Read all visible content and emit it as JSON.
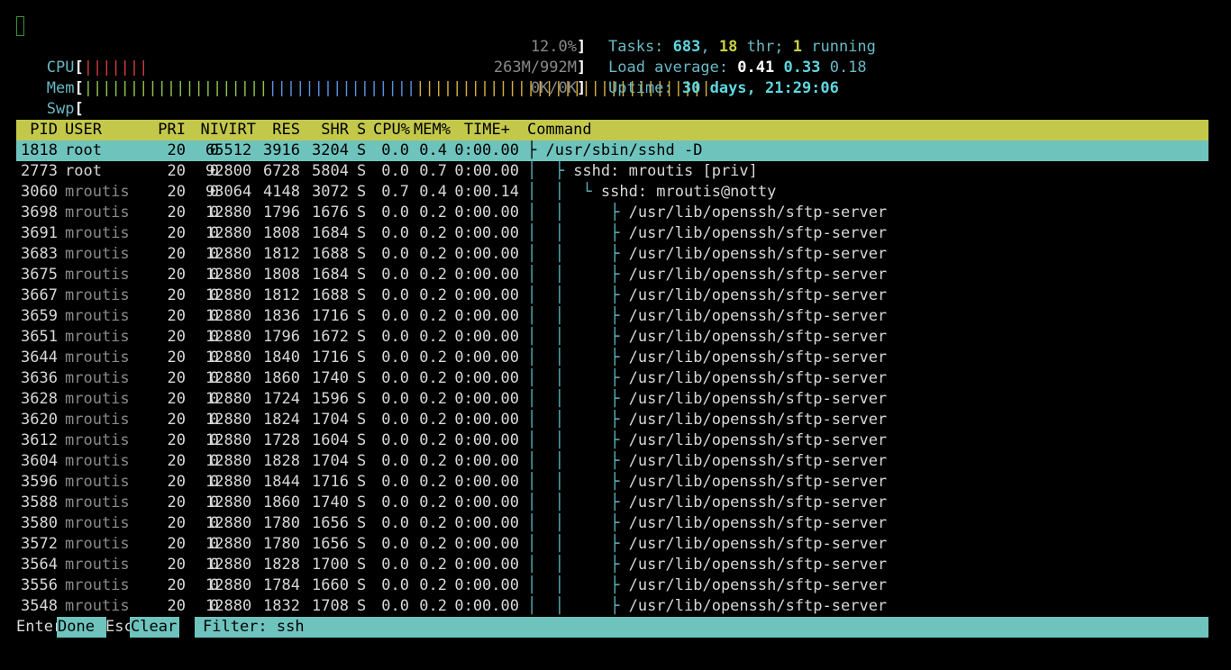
{
  "meters": {
    "cpu": {
      "label": "CPU",
      "value": "12.0%",
      "segments": [
        {
          "color": "#d23c3c",
          "count": 7
        }
      ]
    },
    "mem": {
      "label": "Mem",
      "value": "263M/992M",
      "segments": [
        {
          "color": "#8cc34a",
          "count": 20
        },
        {
          "color": "#5b8fe0",
          "count": 16
        },
        {
          "color": "#d8b03a",
          "count": 32
        }
      ]
    },
    "swp": {
      "label": "Swp",
      "value": "0K/0K",
      "segments": []
    }
  },
  "summary": {
    "tasks_label": "Tasks: ",
    "tasks": "683",
    "thr": "18",
    "thr_label": " thr; ",
    "running": "1",
    "running_label": " running",
    "load_label": "Load average: ",
    "load1": "0.41",
    "load5": "0.33",
    "load15": "0.18",
    "uptime_label": "Uptime: ",
    "uptime": "30 days, 21:29:06"
  },
  "columns": {
    "pid": "PID",
    "user": "USER",
    "pri": "PRI",
    "ni": "NI",
    "virt": "VIRT",
    "res": "RES",
    "shr": "SHR",
    "s": "S",
    "cpu": "CPU%",
    "mem": "MEM%",
    "time": "TIME+",
    "command": "Command"
  },
  "processes": [
    {
      "pid": "1818",
      "user": "root",
      "pri": "20",
      "ni": "0",
      "virt": "65512",
      "res": "3916",
      "shr": "3204",
      "s": "S",
      "cpu": "0.0",
      "mem": "0.4",
      "time": "0:00.00",
      "tree": "├ ",
      "command": "/usr/sbin/sshd -D"
    },
    {
      "pid": "2773",
      "user": "root",
      "pri": "20",
      "ni": "0",
      "virt": "92800",
      "res": "6728",
      "shr": "5804",
      "s": "S",
      "cpu": "0.0",
      "mem": "0.7",
      "time": "0:00.00",
      "tree": "│  ├ ",
      "command": "sshd: mroutis [priv]"
    },
    {
      "pid": "3060",
      "user": "mroutis",
      "pri": "20",
      "ni": "0",
      "virt": "93064",
      "res": "4148",
      "shr": "3072",
      "s": "S",
      "cpu": "0.7",
      "mem": "0.4",
      "time": "0:00.14",
      "tree": "│  │  └ ",
      "command": "sshd: mroutis@notty"
    },
    {
      "pid": "3698",
      "user": "mroutis",
      "pri": "20",
      "ni": "0",
      "virt": "12880",
      "res": "1796",
      "shr": "1676",
      "s": "S",
      "cpu": "0.0",
      "mem": "0.2",
      "time": "0:00.00",
      "tree": "│  │     ├ ",
      "command": "/usr/lib/openssh/sftp-server"
    },
    {
      "pid": "3691",
      "user": "mroutis",
      "pri": "20",
      "ni": "0",
      "virt": "12880",
      "res": "1808",
      "shr": "1684",
      "s": "S",
      "cpu": "0.0",
      "mem": "0.2",
      "time": "0:00.00",
      "tree": "│  │     ├ ",
      "command": "/usr/lib/openssh/sftp-server"
    },
    {
      "pid": "3683",
      "user": "mroutis",
      "pri": "20",
      "ni": "0",
      "virt": "12880",
      "res": "1812",
      "shr": "1688",
      "s": "S",
      "cpu": "0.0",
      "mem": "0.2",
      "time": "0:00.00",
      "tree": "│  │     ├ ",
      "command": "/usr/lib/openssh/sftp-server"
    },
    {
      "pid": "3675",
      "user": "mroutis",
      "pri": "20",
      "ni": "0",
      "virt": "12880",
      "res": "1808",
      "shr": "1684",
      "s": "S",
      "cpu": "0.0",
      "mem": "0.2",
      "time": "0:00.00",
      "tree": "│  │     ├ ",
      "command": "/usr/lib/openssh/sftp-server"
    },
    {
      "pid": "3667",
      "user": "mroutis",
      "pri": "20",
      "ni": "0",
      "virt": "12880",
      "res": "1812",
      "shr": "1688",
      "s": "S",
      "cpu": "0.0",
      "mem": "0.2",
      "time": "0:00.00",
      "tree": "│  │     ├ ",
      "command": "/usr/lib/openssh/sftp-server"
    },
    {
      "pid": "3659",
      "user": "mroutis",
      "pri": "20",
      "ni": "0",
      "virt": "12880",
      "res": "1836",
      "shr": "1716",
      "s": "S",
      "cpu": "0.0",
      "mem": "0.2",
      "time": "0:00.00",
      "tree": "│  │     ├ ",
      "command": "/usr/lib/openssh/sftp-server"
    },
    {
      "pid": "3651",
      "user": "mroutis",
      "pri": "20",
      "ni": "0",
      "virt": "12880",
      "res": "1796",
      "shr": "1672",
      "s": "S",
      "cpu": "0.0",
      "mem": "0.2",
      "time": "0:00.00",
      "tree": "│  │     ├ ",
      "command": "/usr/lib/openssh/sftp-server"
    },
    {
      "pid": "3644",
      "user": "mroutis",
      "pri": "20",
      "ni": "0",
      "virt": "12880",
      "res": "1840",
      "shr": "1716",
      "s": "S",
      "cpu": "0.0",
      "mem": "0.2",
      "time": "0:00.00",
      "tree": "│  │     ├ ",
      "command": "/usr/lib/openssh/sftp-server"
    },
    {
      "pid": "3636",
      "user": "mroutis",
      "pri": "20",
      "ni": "0",
      "virt": "12880",
      "res": "1860",
      "shr": "1740",
      "s": "S",
      "cpu": "0.0",
      "mem": "0.2",
      "time": "0:00.00",
      "tree": "│  │     ├ ",
      "command": "/usr/lib/openssh/sftp-server"
    },
    {
      "pid": "3628",
      "user": "mroutis",
      "pri": "20",
      "ni": "0",
      "virt": "12880",
      "res": "1724",
      "shr": "1596",
      "s": "S",
      "cpu": "0.0",
      "mem": "0.2",
      "time": "0:00.00",
      "tree": "│  │     ├ ",
      "command": "/usr/lib/openssh/sftp-server"
    },
    {
      "pid": "3620",
      "user": "mroutis",
      "pri": "20",
      "ni": "0",
      "virt": "12880",
      "res": "1824",
      "shr": "1704",
      "s": "S",
      "cpu": "0.0",
      "mem": "0.2",
      "time": "0:00.00",
      "tree": "│  │     ├ ",
      "command": "/usr/lib/openssh/sftp-server"
    },
    {
      "pid": "3612",
      "user": "mroutis",
      "pri": "20",
      "ni": "0",
      "virt": "12880",
      "res": "1728",
      "shr": "1604",
      "s": "S",
      "cpu": "0.0",
      "mem": "0.2",
      "time": "0:00.00",
      "tree": "│  │     ├ ",
      "command": "/usr/lib/openssh/sftp-server"
    },
    {
      "pid": "3604",
      "user": "mroutis",
      "pri": "20",
      "ni": "0",
      "virt": "12880",
      "res": "1828",
      "shr": "1704",
      "s": "S",
      "cpu": "0.0",
      "mem": "0.2",
      "time": "0:00.00",
      "tree": "│  │     ├ ",
      "command": "/usr/lib/openssh/sftp-server"
    },
    {
      "pid": "3596",
      "user": "mroutis",
      "pri": "20",
      "ni": "0",
      "virt": "12880",
      "res": "1844",
      "shr": "1716",
      "s": "S",
      "cpu": "0.0",
      "mem": "0.2",
      "time": "0:00.00",
      "tree": "│  │     ├ ",
      "command": "/usr/lib/openssh/sftp-server"
    },
    {
      "pid": "3588",
      "user": "mroutis",
      "pri": "20",
      "ni": "0",
      "virt": "12880",
      "res": "1860",
      "shr": "1740",
      "s": "S",
      "cpu": "0.0",
      "mem": "0.2",
      "time": "0:00.00",
      "tree": "│  │     ├ ",
      "command": "/usr/lib/openssh/sftp-server"
    },
    {
      "pid": "3580",
      "user": "mroutis",
      "pri": "20",
      "ni": "0",
      "virt": "12880",
      "res": "1780",
      "shr": "1656",
      "s": "S",
      "cpu": "0.0",
      "mem": "0.2",
      "time": "0:00.00",
      "tree": "│  │     ├ ",
      "command": "/usr/lib/openssh/sftp-server"
    },
    {
      "pid": "3572",
      "user": "mroutis",
      "pri": "20",
      "ni": "0",
      "virt": "12880",
      "res": "1780",
      "shr": "1656",
      "s": "S",
      "cpu": "0.0",
      "mem": "0.2",
      "time": "0:00.00",
      "tree": "│  │     ├ ",
      "command": "/usr/lib/openssh/sftp-server"
    },
    {
      "pid": "3564",
      "user": "mroutis",
      "pri": "20",
      "ni": "0",
      "virt": "12880",
      "res": "1828",
      "shr": "1700",
      "s": "S",
      "cpu": "0.0",
      "mem": "0.2",
      "time": "0:00.00",
      "tree": "│  │     ├ ",
      "command": "/usr/lib/openssh/sftp-server"
    },
    {
      "pid": "3556",
      "user": "mroutis",
      "pri": "20",
      "ni": "0",
      "virt": "12880",
      "res": "1784",
      "shr": "1660",
      "s": "S",
      "cpu": "0.0",
      "mem": "0.2",
      "time": "0:00.00",
      "tree": "│  │     ├ ",
      "command": "/usr/lib/openssh/sftp-server"
    },
    {
      "pid": "3548",
      "user": "mroutis",
      "pri": "20",
      "ni": "0",
      "virt": "12880",
      "res": "1832",
      "shr": "1708",
      "s": "S",
      "cpu": "0.0",
      "mem": "0.2",
      "time": "0:00.00",
      "tree": "│  │     ├ ",
      "command": "/usr/lib/openssh/sftp-server"
    }
  ],
  "footer": {
    "enter_key": "Enter",
    "enter_action": "Done",
    "esc_key": "Esc",
    "esc_action": "Clear",
    "filter_label": "Filter: ",
    "filter_value": "ssh"
  }
}
